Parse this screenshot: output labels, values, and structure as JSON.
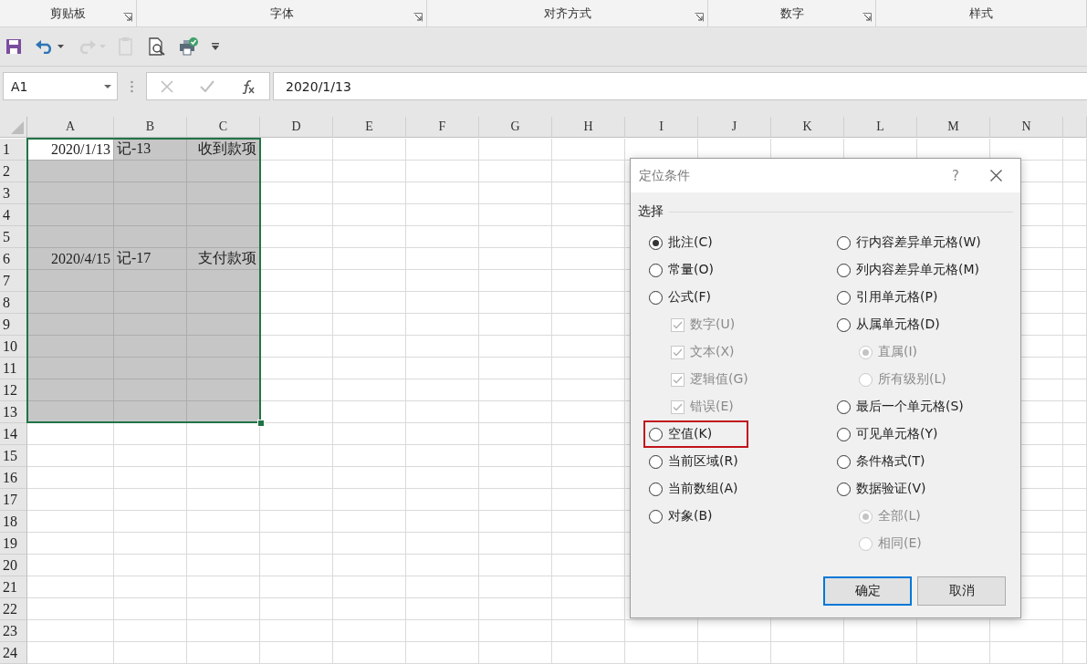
{
  "ribbon_groups": [
    {
      "label": "剪贴板",
      "launcher": true
    },
    {
      "label": "字体",
      "launcher": true
    },
    {
      "label": "对齐方式",
      "launcher": true
    },
    {
      "label": "数字",
      "launcher": true
    },
    {
      "label": "样式",
      "launcher": false
    }
  ],
  "quick_access": [
    {
      "kind": "save",
      "disabled": false
    },
    {
      "kind": "undo",
      "disabled": false
    },
    {
      "kind": "redo",
      "disabled": true
    },
    {
      "kind": "paste",
      "disabled": true
    },
    {
      "kind": "preview",
      "disabled": false
    },
    {
      "kind": "print",
      "disabled": false
    },
    {
      "kind": "customize",
      "disabled": false
    }
  ],
  "formula_bar": {
    "name_box": "A1",
    "value": "2020/1/13"
  },
  "sheet": {
    "columns": [
      "A",
      "B",
      "C",
      "D",
      "E",
      "F",
      "G",
      "H",
      "I",
      "J",
      "K",
      "L",
      "M",
      "N"
    ],
    "rows": [
      {
        "header": "1",
        "cells": [
          {
            "text": "2020/1/13",
            "selected": true,
            "active": true
          },
          {
            "text": "记-13",
            "selected": true,
            "active": false
          },
          {
            "text": "收到款项",
            "selected": true,
            "active": false
          }
        ]
      },
      {
        "header": "2",
        "cells": [
          {
            "selected": true,
            "active": false
          },
          {
            "selected": true,
            "active": false
          },
          {
            "selected": true,
            "active": false
          }
        ]
      },
      {
        "header": "3",
        "cells": [
          {
            "selected": true,
            "active": false
          },
          {
            "selected": true,
            "active": false
          },
          {
            "selected": true,
            "active": false
          }
        ]
      },
      {
        "header": "4",
        "cells": [
          {
            "selected": true,
            "active": false
          },
          {
            "selected": true,
            "active": false
          },
          {
            "selected": true,
            "active": false
          }
        ]
      },
      {
        "header": "5",
        "cells": [
          {
            "selected": true,
            "active": false
          },
          {
            "selected": true,
            "active": false
          },
          {
            "selected": true,
            "active": false
          }
        ]
      },
      {
        "header": "6",
        "cells": [
          {
            "text": "2020/4/15",
            "selected": true,
            "active": false
          },
          {
            "text": "记-17",
            "selected": true,
            "active": false
          },
          {
            "text": "支付款项",
            "selected": true,
            "active": false
          }
        ]
      },
      {
        "header": "7",
        "cells": [
          {
            "selected": true,
            "active": false
          },
          {
            "selected": true,
            "active": false
          },
          {
            "selected": true,
            "active": false
          }
        ]
      },
      {
        "header": "8",
        "cells": [
          {
            "selected": true,
            "active": false
          },
          {
            "selected": true,
            "active": false
          },
          {
            "selected": true,
            "active": false
          }
        ]
      },
      {
        "header": "9",
        "cells": [
          {
            "selected": true,
            "active": false
          },
          {
            "selected": true,
            "active": false
          },
          {
            "selected": true,
            "active": false
          }
        ]
      },
      {
        "header": "10",
        "cells": [
          {
            "selected": true,
            "active": false
          },
          {
            "selected": true,
            "active": false
          },
          {
            "selected": true,
            "active": false
          }
        ]
      },
      {
        "header": "11",
        "cells": [
          {
            "selected": true,
            "active": false
          },
          {
            "selected": true,
            "active": false
          },
          {
            "selected": true,
            "active": false
          }
        ]
      },
      {
        "header": "12",
        "cells": [
          {
            "selected": true,
            "active": false
          },
          {
            "selected": true,
            "active": false
          },
          {
            "selected": true,
            "active": false
          }
        ]
      },
      {
        "header": "13",
        "cells": [
          {
            "selected": true,
            "active": false
          },
          {
            "selected": true,
            "active": false
          },
          {
            "selected": true,
            "active": false
          }
        ]
      },
      {
        "header": "14"
      },
      {
        "header": "15"
      },
      {
        "header": "16"
      },
      {
        "header": "17"
      },
      {
        "header": "18"
      },
      {
        "header": "19"
      },
      {
        "header": "20"
      },
      {
        "header": "21"
      },
      {
        "header": "22"
      },
      {
        "header": "23"
      },
      {
        "header": "24"
      }
    ]
  },
  "dialog": {
    "title": "定位条件",
    "help": "?",
    "group_label": "选择",
    "columns": [
      [
        {
          "kind": "radio",
          "label": "批注(C)",
          "selected": true,
          "disabled": false,
          "highlighted": false
        },
        {
          "kind": "radio",
          "label": "常量(O)",
          "selected": false,
          "disabled": false,
          "highlighted": false
        },
        {
          "kind": "radio",
          "label": "公式(F)",
          "selected": false,
          "disabled": false,
          "highlighted": false,
          "children": [
            {
              "kind": "checkbox",
              "label": "数字(U)",
              "checked": true,
              "disabled": true
            },
            {
              "kind": "checkbox",
              "label": "文本(X)",
              "checked": true,
              "disabled": true
            },
            {
              "kind": "checkbox",
              "label": "逻辑值(G)",
              "checked": true,
              "disabled": true
            },
            {
              "kind": "checkbox",
              "label": "错误(E)",
              "checked": true,
              "disabled": true
            }
          ]
        },
        {
          "kind": "radio",
          "label": "空值(K)",
          "selected": false,
          "disabled": false,
          "highlighted": true
        },
        {
          "kind": "radio",
          "label": "当前区域(R)",
          "selected": false,
          "disabled": false,
          "highlighted": false
        },
        {
          "kind": "radio",
          "label": "当前数组(A)",
          "selected": false,
          "disabled": false,
          "highlighted": false
        },
        {
          "kind": "radio",
          "label": "对象(B)",
          "selected": false,
          "disabled": false,
          "highlighted": false
        }
      ],
      [
        {
          "kind": "radio",
          "label": "行内容差异单元格(W)",
          "selected": false,
          "disabled": false,
          "highlighted": false
        },
        {
          "kind": "radio",
          "label": "列内容差异单元格(M)",
          "selected": false,
          "disabled": false,
          "highlighted": false
        },
        {
          "kind": "radio",
          "label": "引用单元格(P)",
          "selected": false,
          "disabled": false,
          "highlighted": false
        },
        {
          "kind": "radio",
          "label": "从属单元格(D)",
          "selected": false,
          "disabled": false,
          "highlighted": false,
          "children": [
            {
              "kind": "radio",
              "label": "直属(I)",
              "selected": true,
              "disabled": true,
              "highlighted": false
            },
            {
              "kind": "radio",
              "label": "所有级别(L)",
              "selected": false,
              "disabled": true,
              "highlighted": false
            }
          ]
        },
        {
          "kind": "radio",
          "label": "最后一个单元格(S)",
          "selected": false,
          "disabled": false,
          "highlighted": false
        },
        {
          "kind": "radio",
          "label": "可见单元格(Y)",
          "selected": false,
          "disabled": false,
          "highlighted": false
        },
        {
          "kind": "radio",
          "label": "条件格式(T)",
          "selected": false,
          "disabled": false,
          "highlighted": false
        },
        {
          "kind": "radio",
          "label": "数据验证(V)",
          "selected": false,
          "disabled": false,
          "highlighted": false,
          "children": [
            {
              "kind": "radio",
              "label": "全部(L)",
              "selected": true,
              "disabled": true,
              "highlighted": false
            },
            {
              "kind": "radio",
              "label": "相同(E)",
              "selected": false,
              "disabled": true,
              "highlighted": false
            }
          ]
        }
      ]
    ],
    "buttons": [
      {
        "label": "确定",
        "default": true
      },
      {
        "label": "取消",
        "default": false
      }
    ]
  }
}
